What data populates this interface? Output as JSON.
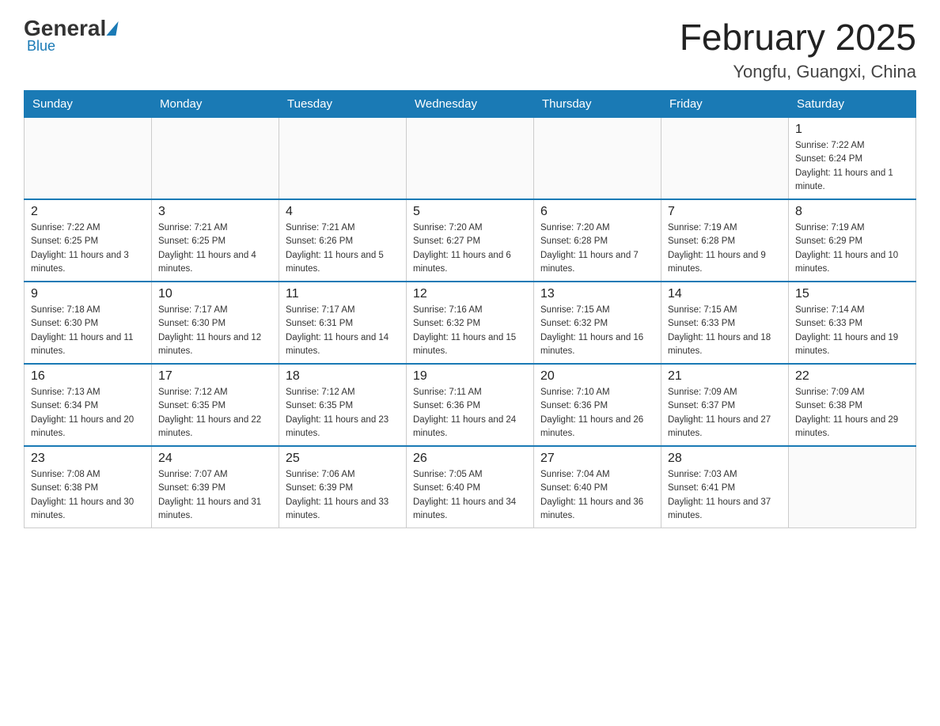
{
  "header": {
    "logo_general": "General",
    "logo_blue": "Blue",
    "title": "February 2025",
    "subtitle": "Yongfu, Guangxi, China"
  },
  "weekdays": [
    "Sunday",
    "Monday",
    "Tuesday",
    "Wednesday",
    "Thursday",
    "Friday",
    "Saturday"
  ],
  "rows": [
    {
      "cells": [
        {
          "empty": true
        },
        {
          "empty": true
        },
        {
          "empty": true
        },
        {
          "empty": true
        },
        {
          "empty": true
        },
        {
          "empty": true
        },
        {
          "day": "1",
          "sunrise": "7:22 AM",
          "sunset": "6:24 PM",
          "daylight": "11 hours and 1 minute."
        }
      ]
    },
    {
      "cells": [
        {
          "day": "2",
          "sunrise": "7:22 AM",
          "sunset": "6:25 PM",
          "daylight": "11 hours and 3 minutes."
        },
        {
          "day": "3",
          "sunrise": "7:21 AM",
          "sunset": "6:25 PM",
          "daylight": "11 hours and 4 minutes."
        },
        {
          "day": "4",
          "sunrise": "7:21 AM",
          "sunset": "6:26 PM",
          "daylight": "11 hours and 5 minutes."
        },
        {
          "day": "5",
          "sunrise": "7:20 AM",
          "sunset": "6:27 PM",
          "daylight": "11 hours and 6 minutes."
        },
        {
          "day": "6",
          "sunrise": "7:20 AM",
          "sunset": "6:28 PM",
          "daylight": "11 hours and 7 minutes."
        },
        {
          "day": "7",
          "sunrise": "7:19 AM",
          "sunset": "6:28 PM",
          "daylight": "11 hours and 9 minutes."
        },
        {
          "day": "8",
          "sunrise": "7:19 AM",
          "sunset": "6:29 PM",
          "daylight": "11 hours and 10 minutes."
        }
      ]
    },
    {
      "cells": [
        {
          "day": "9",
          "sunrise": "7:18 AM",
          "sunset": "6:30 PM",
          "daylight": "11 hours and 11 minutes."
        },
        {
          "day": "10",
          "sunrise": "7:17 AM",
          "sunset": "6:30 PM",
          "daylight": "11 hours and 12 minutes."
        },
        {
          "day": "11",
          "sunrise": "7:17 AM",
          "sunset": "6:31 PM",
          "daylight": "11 hours and 14 minutes."
        },
        {
          "day": "12",
          "sunrise": "7:16 AM",
          "sunset": "6:32 PM",
          "daylight": "11 hours and 15 minutes."
        },
        {
          "day": "13",
          "sunrise": "7:15 AM",
          "sunset": "6:32 PM",
          "daylight": "11 hours and 16 minutes."
        },
        {
          "day": "14",
          "sunrise": "7:15 AM",
          "sunset": "6:33 PM",
          "daylight": "11 hours and 18 minutes."
        },
        {
          "day": "15",
          "sunrise": "7:14 AM",
          "sunset": "6:33 PM",
          "daylight": "11 hours and 19 minutes."
        }
      ]
    },
    {
      "cells": [
        {
          "day": "16",
          "sunrise": "7:13 AM",
          "sunset": "6:34 PM",
          "daylight": "11 hours and 20 minutes."
        },
        {
          "day": "17",
          "sunrise": "7:12 AM",
          "sunset": "6:35 PM",
          "daylight": "11 hours and 22 minutes."
        },
        {
          "day": "18",
          "sunrise": "7:12 AM",
          "sunset": "6:35 PM",
          "daylight": "11 hours and 23 minutes."
        },
        {
          "day": "19",
          "sunrise": "7:11 AM",
          "sunset": "6:36 PM",
          "daylight": "11 hours and 24 minutes."
        },
        {
          "day": "20",
          "sunrise": "7:10 AM",
          "sunset": "6:36 PM",
          "daylight": "11 hours and 26 minutes."
        },
        {
          "day": "21",
          "sunrise": "7:09 AM",
          "sunset": "6:37 PM",
          "daylight": "11 hours and 27 minutes."
        },
        {
          "day": "22",
          "sunrise": "7:09 AM",
          "sunset": "6:38 PM",
          "daylight": "11 hours and 29 minutes."
        }
      ]
    },
    {
      "cells": [
        {
          "day": "23",
          "sunrise": "7:08 AM",
          "sunset": "6:38 PM",
          "daylight": "11 hours and 30 minutes."
        },
        {
          "day": "24",
          "sunrise": "7:07 AM",
          "sunset": "6:39 PM",
          "daylight": "11 hours and 31 minutes."
        },
        {
          "day": "25",
          "sunrise": "7:06 AM",
          "sunset": "6:39 PM",
          "daylight": "11 hours and 33 minutes."
        },
        {
          "day": "26",
          "sunrise": "7:05 AM",
          "sunset": "6:40 PM",
          "daylight": "11 hours and 34 minutes."
        },
        {
          "day": "27",
          "sunrise": "7:04 AM",
          "sunset": "6:40 PM",
          "daylight": "11 hours and 36 minutes."
        },
        {
          "day": "28",
          "sunrise": "7:03 AM",
          "sunset": "6:41 PM",
          "daylight": "11 hours and 37 minutes."
        },
        {
          "empty": true
        }
      ]
    }
  ]
}
